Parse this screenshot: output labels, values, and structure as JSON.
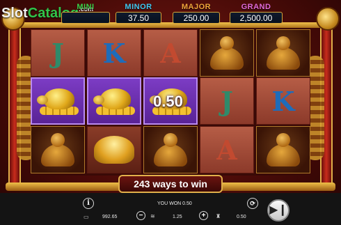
{
  "logo": {
    "part1": "Slot",
    "part2": "Catalog",
    "suffix": ".com"
  },
  "jackpots": {
    "mini": {
      "label": "MINI",
      "color": "#3fd14a"
    },
    "minor": {
      "label": "MINOR",
      "value": "37.50",
      "color": "#43c8f0"
    },
    "major": {
      "label": "MAJOR",
      "value": "250.00",
      "color": "#f2a43a"
    },
    "grand": {
      "label": "GRAND",
      "value": "2,500.00",
      "color": "#e46ad8"
    }
  },
  "reels": {
    "rows": [
      [
        "J",
        "K",
        "A",
        "buddha",
        "buddha"
      ],
      [
        "turtle",
        "turtle",
        "turtle",
        "J",
        "K"
      ],
      [
        "buddha",
        "ingot",
        "buddha",
        "A",
        "buddha"
      ]
    ],
    "turtle_win_value": "0.50"
  },
  "ways_banner": "243 ways to win",
  "bottom_bar": {
    "info_icon": "i",
    "balance": "992.65",
    "you_won": "YOU WON 0.50",
    "minus_icon": "−",
    "bet": "1.25",
    "plus_icon": "+",
    "win": "0.50",
    "spin_icon": "▶❙"
  },
  "colors": {
    "turtle_highlight": "#7c3cc4",
    "frame_gold": "#e2b04a",
    "background_red": "#7a1a14"
  }
}
